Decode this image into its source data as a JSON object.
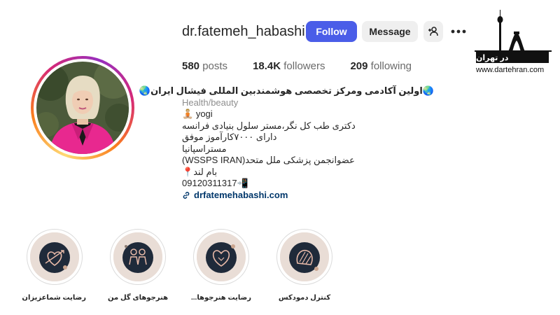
{
  "profile": {
    "username": "dr.fatemeh_habashi",
    "follow_label": "Follow",
    "message_label": "Message"
  },
  "stats": {
    "posts_count": "580",
    "posts_label": "posts",
    "followers_count": "18.4K",
    "followers_label": "followers",
    "following_count": "209",
    "following_label": "following"
  },
  "bio": {
    "name": "اولین آکادمی ومرکز تخصصی هوشمندبین المللی فیشال ایران",
    "category": "Health/beauty",
    "lines": [
      "yogi",
      "دکتری طب کل نگر،مستر سلول بنیادی فرانسه",
      "دارای ۷۰۰۰کارآموز موفق",
      "مستراسپانیا",
      "(WSSPS IRAN)عضوانجمن پزشکی ملل متحد",
      "بام لند",
      "09120311317"
    ],
    "link": "drfatemehabashi.com"
  },
  "watermark": {
    "brand": "در تهران",
    "url": "www.dartehran.com"
  },
  "highlights": [
    {
      "label": "رضایت شماعزیزان",
      "icon": "heart-arrow-icon"
    },
    {
      "label": "هنرجوهای گل من",
      "icon": "people-icon"
    },
    {
      "label": "رضایت هنرجوها...",
      "icon": "heart-icon"
    },
    {
      "label": "کنترل دمودکس",
      "icon": "shell-icon"
    }
  ],
  "colors": {
    "follow_button": "#4a5de8",
    "secondary_button": "#efefef",
    "link": "#00376b",
    "avatar_outfit": "#e8288f"
  },
  "icons": {
    "suggest": "person-add-icon",
    "more": "more-horizontal-icon",
    "link": "link-icon",
    "name_emoji": "globe-icon",
    "yogi_emoji": "person-in-lotus-position-icon",
    "location_emoji": "round-pushpin-icon",
    "phone_emoji": "mobile-phone-arrow-icon"
  }
}
